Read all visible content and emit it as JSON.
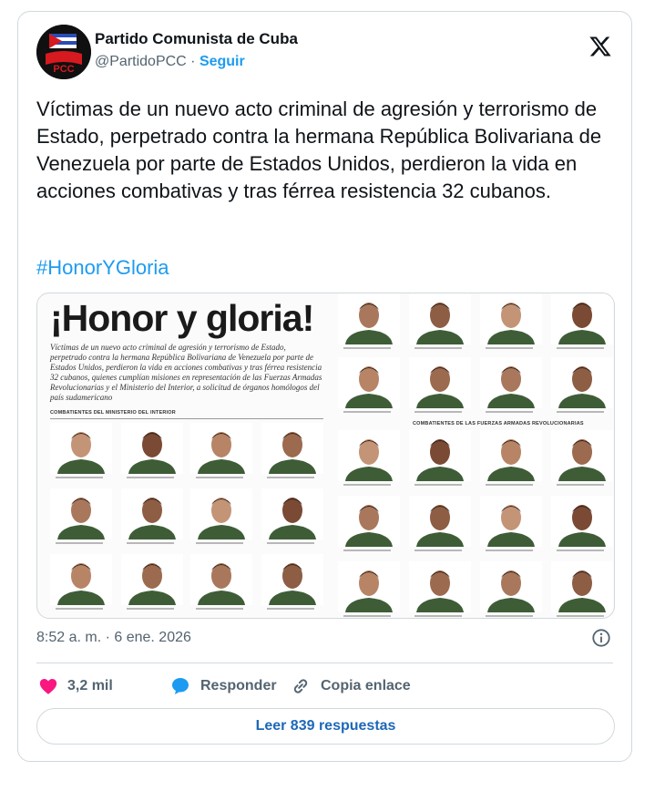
{
  "account": {
    "display_name": "Partido Comunista de Cuba",
    "handle": "@PartidoPCC",
    "separator": " · ",
    "follow_label": "Seguir",
    "avatar_logo": "PCC"
  },
  "tweet": {
    "text": "Víctimas de un nuevo acto criminal de agresión y terrorismo de Estado, perpetrado contra la hermana República Bolivariana de Venezuela por parte de Estados Unidos, perdieron la vida en acciones combativas y tras férrea resistencia 32 cubanos.",
    "hashtag": "#HonorYGloria",
    "timestamp": "8:52 a. m. · 6 ene. 2026"
  },
  "media": {
    "title": "¡Honor y gloria!",
    "body": "Víctimas de un nuevo acto criminal de agresión y terrorismo de Estado, perpetrado contra la hermana República Bolivariana de Venezuela por parte de Estados Unidos, perdieron la vida en acciones combativas y tras férrea resistencia 32 cubanos, quienes cumplían misiones en representación de las Fuerzas Armadas Revolucionarias y el Ministerio del Interior, a solicitud de órganos homólogos del país sudamericano",
    "section_minint": "COMBATIENTES DEL MINISTERIO DEL INTERIOR",
    "section_far": "COMBATIENTES DE LAS FUERZAS ARMADAS REVOLUCIONARIAS",
    "portrait_count": 32
  },
  "actions": {
    "likes": "3,2 mil",
    "reply_label": "Responder",
    "copy_label": "Copia enlace",
    "read_replies": "Leer 839 respuestas"
  },
  "colors": {
    "link_blue": "#1d9bf0",
    "heart": "#f91880",
    "muted": "#536471",
    "border": "#cfd9de"
  },
  "icons": [
    "x-logo-icon",
    "info-icon",
    "heart-icon",
    "reply-bubble-icon",
    "link-icon"
  ]
}
